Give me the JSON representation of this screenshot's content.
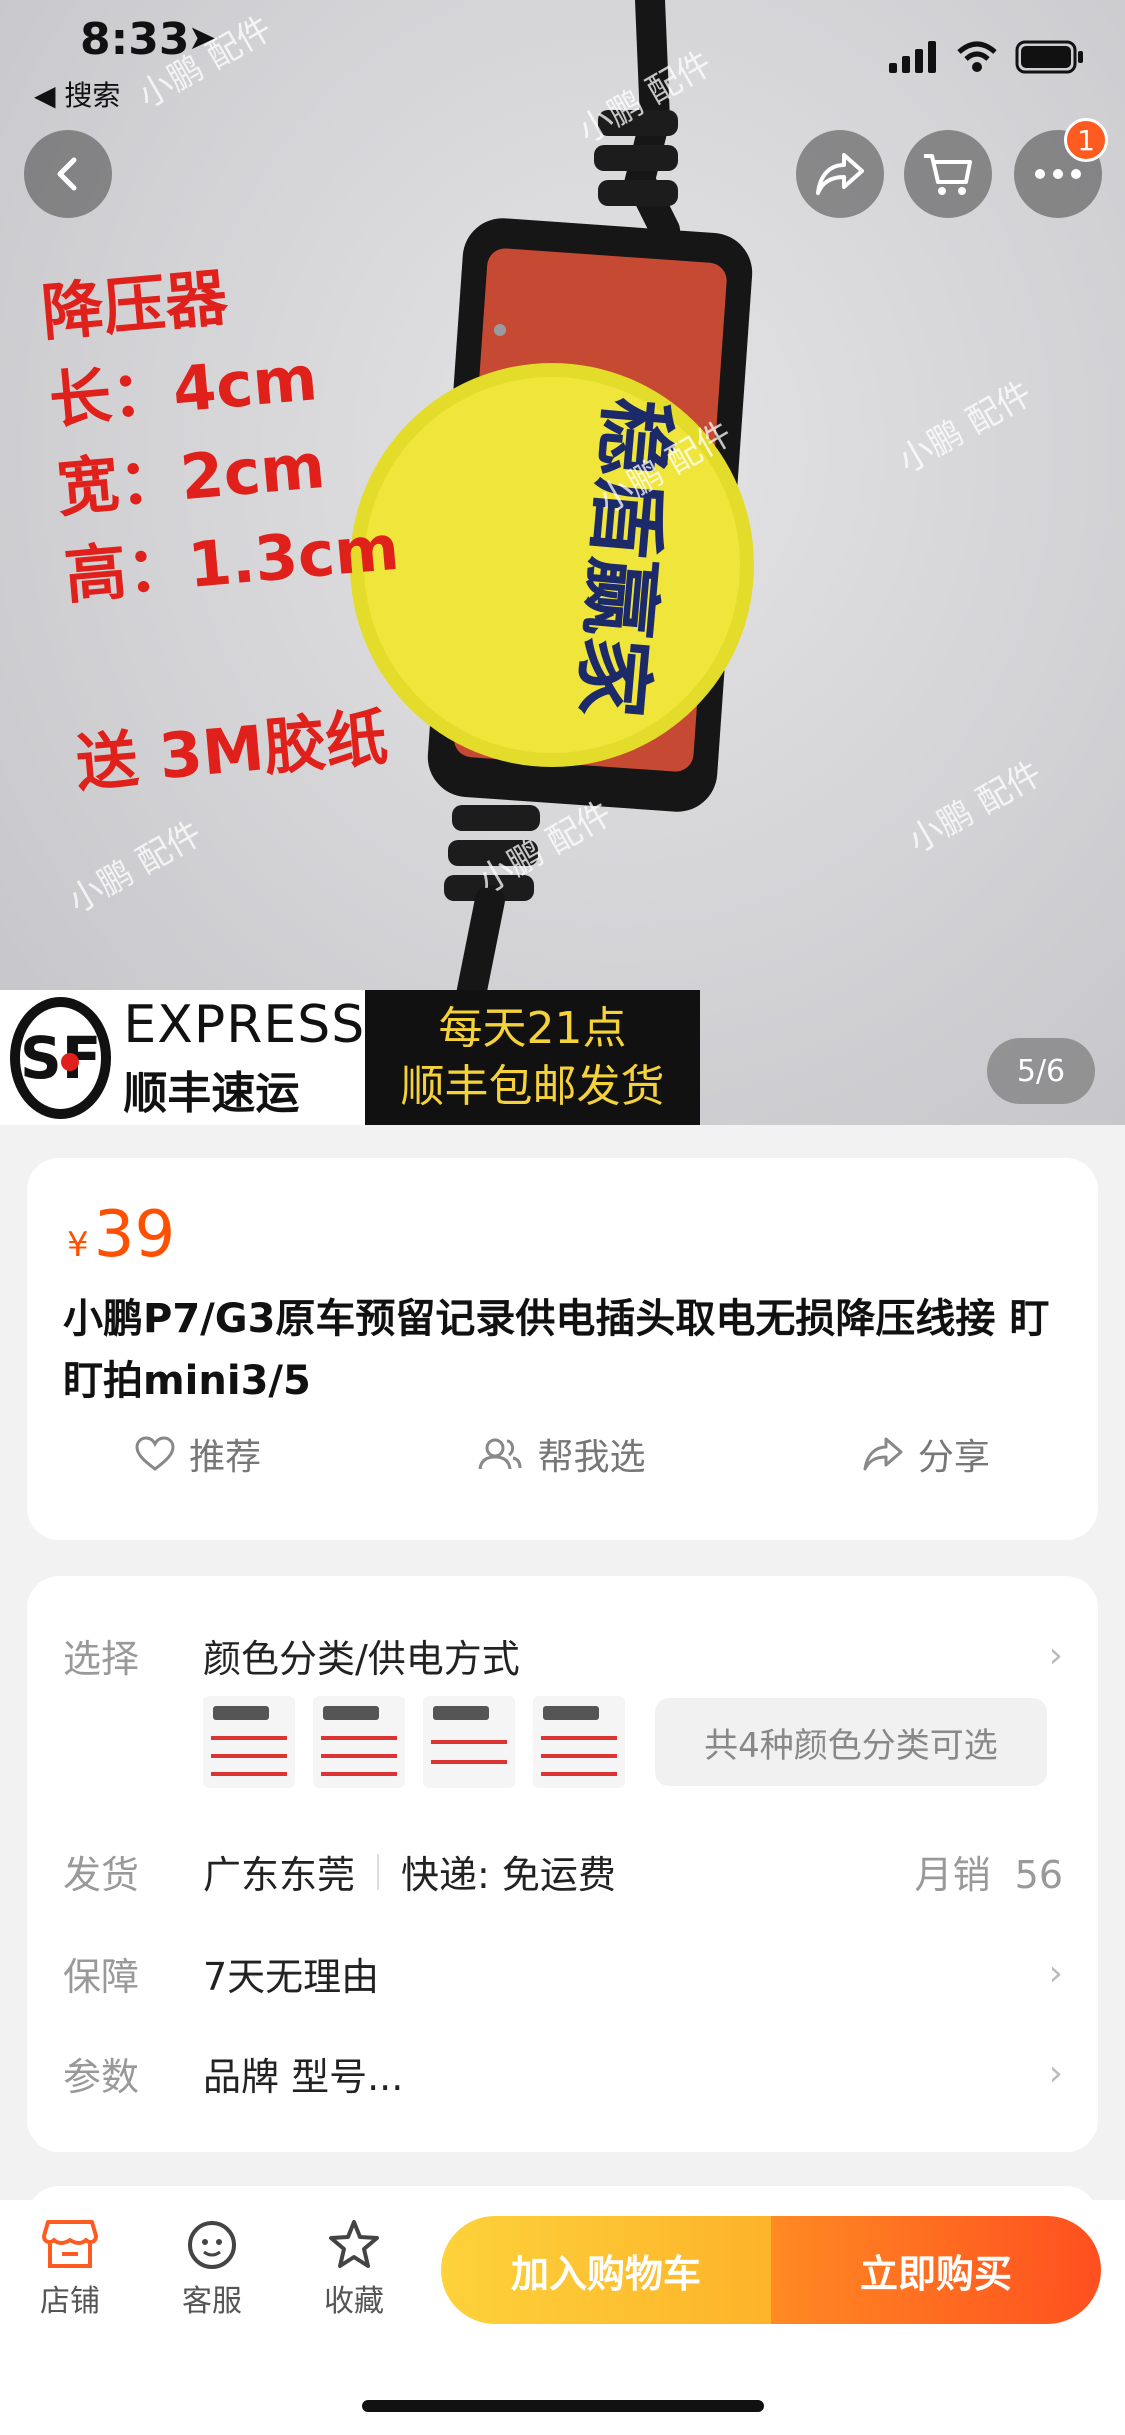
{
  "status_bar": {
    "time": "8:33",
    "back_app": "◀ 搜索"
  },
  "nav": {
    "cart_badge": "1"
  },
  "hero": {
    "watermark": "小鹏 配件",
    "spec_lines": [
      "降压器",
      "长：4cm",
      "宽：2cm",
      "高：1.3cm"
    ],
    "gift": "送 3M胶纸",
    "cap_text": "稳盾赢家",
    "sf_logo": "SF",
    "sf_en": "EXPRESS",
    "sf_cn": "顺丰速运",
    "sf_line1": "每天21点",
    "sf_line2": "顺丰包邮发货",
    "page_indicator": "5/6"
  },
  "product": {
    "currency": "¥",
    "price": "39",
    "title": "小鹏P7/G3原车预留记录供电插头取电无损降压线接 盯盯拍mini3/5",
    "actions": [
      {
        "label": "推荐",
        "icon": "heart-icon"
      },
      {
        "label": "帮我选",
        "icon": "people-icon"
      },
      {
        "label": "分享",
        "icon": "share-icon"
      }
    ]
  },
  "options": {
    "select_label": "选择",
    "select_value": "颜色分类/供电方式",
    "all_colors": "共4种颜色分类可选",
    "ship_label": "发货",
    "ship_from": "广东东莞",
    "ship_fee": "快递: 免运费",
    "monthly_sales_label": "月销",
    "monthly_sales": "56",
    "guarantee_label": "保障",
    "guarantee_value": "7天无理由",
    "params_label": "参数",
    "params_value": "品牌 型号..."
  },
  "bottom_bar": {
    "store": "店铺",
    "service": "客服",
    "favorite": "收藏",
    "add_cart": "加入购物车",
    "buy_now": "立即购买"
  },
  "colors": {
    "accent": "#ff5000",
    "cart_btn": "#fdc532",
    "buy_btn": "#ff5a1f"
  }
}
